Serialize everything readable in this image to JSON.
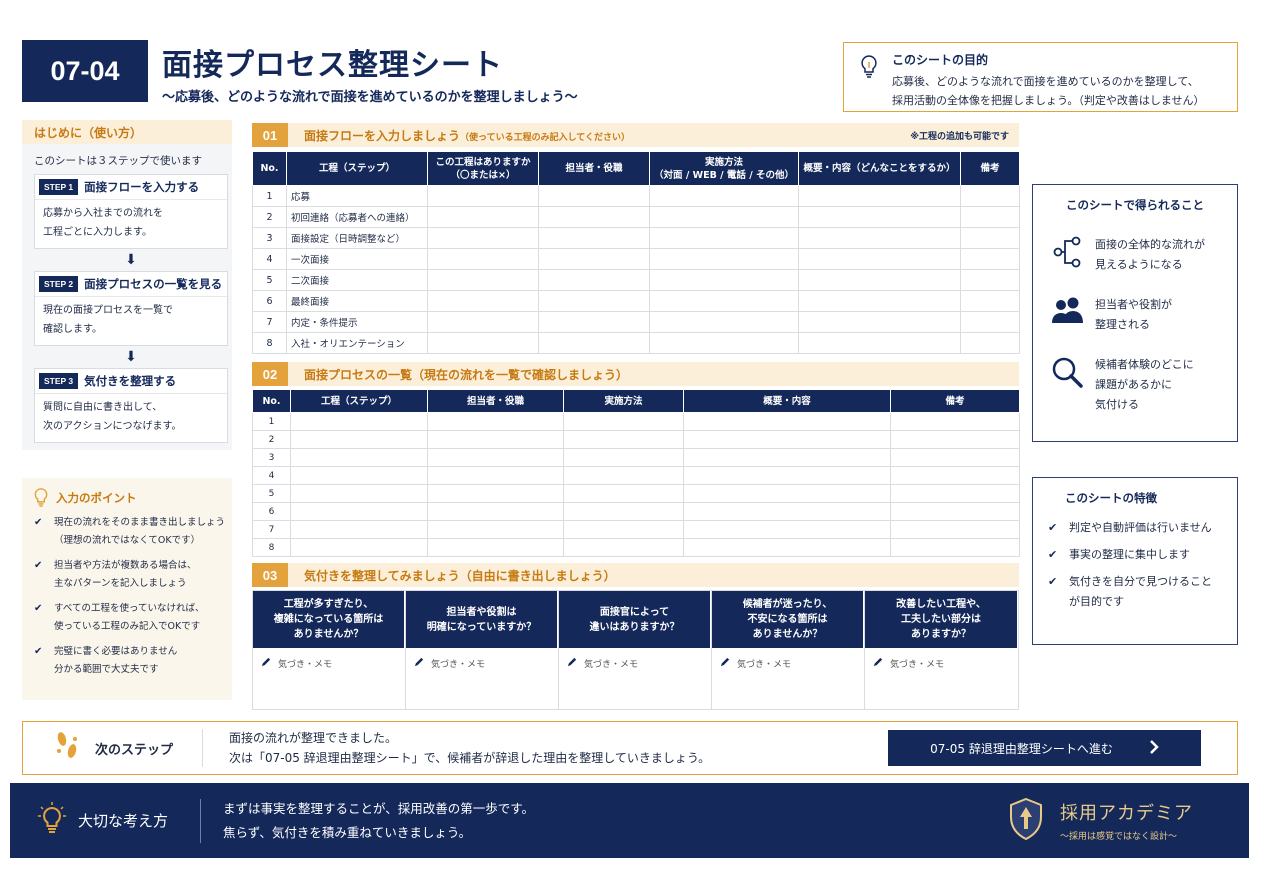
{
  "header": {
    "code": "07-04",
    "title": "面接プロセス整理シート",
    "subtitle": "〜応募後、どのような流れで面接を進めているのかを整理しましょう〜"
  },
  "purpose": {
    "title": "このシートの目的",
    "line1": "応募後、どのような流れで面接を進めているのかを整理して、",
    "line2": "採用活動の全体像を把握しましょう。（判定や改善はしません）"
  },
  "intro": {
    "heading": "はじめに（使い方）",
    "text": "このシートは３ステップで使います",
    "steps": [
      {
        "tag": "STEP 1",
        "title": "面接フローを入力する",
        "line1": "応募から入社までの流れを",
        "line2": "工程ごとに入力します。"
      },
      {
        "tag": "STEP 2",
        "title": "面接プロセスの一覧を見る",
        "line1": "現在の面接プロセスを一覧で",
        "line2": "確認します。"
      },
      {
        "tag": "STEP 3",
        "title": "気付きを整理する",
        "line1": "質問に自由に書き出して、",
        "line2": "次のアクションにつなげます。"
      }
    ]
  },
  "points": {
    "heading": "入力のポイント",
    "items": [
      {
        "line1": "現在の流れをそのまま書き出しましょう",
        "line2": "（理想の流れではなくてOKです）"
      },
      {
        "line1": "担当者や方法が複数ある場合は、",
        "line2": "主なパターンを記入しましょう"
      },
      {
        "line1": "すべての工程を使っていなければ、",
        "line2": "使っている工程のみ記入でOKです"
      },
      {
        "line1": "完璧に書く必要はありません",
        "line2": "分かる範囲で大丈夫です"
      }
    ]
  },
  "section1": {
    "num": "01",
    "title": "面接フローを入力しましょう",
    "title_small": "（使っている工程のみ記入してください）",
    "note": "※工程の追加も可能です",
    "headers": [
      "No.",
      "工程（ステップ）",
      "この工程はありますか\n（〇または×）",
      "担当者・役職",
      "実施方法\n（対面 / WEB / 電話 / その他）",
      "概要・内容（どんなことをするか）",
      "備考"
    ],
    "rows": [
      {
        "no": "1",
        "step": "応募"
      },
      {
        "no": "2",
        "step": "初回連絡（応募者への連絡）"
      },
      {
        "no": "3",
        "step": "面接設定（日時調整など）"
      },
      {
        "no": "4",
        "step": "一次面接"
      },
      {
        "no": "5",
        "step": "二次面接"
      },
      {
        "no": "6",
        "step": "最終面接"
      },
      {
        "no": "7",
        "step": "内定・条件提示"
      },
      {
        "no": "8",
        "step": "入社・オリエンテーション"
      }
    ]
  },
  "section2": {
    "num": "02",
    "title": "面接プロセスの一覧（現在の流れを一覧で確認しましょう）",
    "headers": [
      "No.",
      "工程（ステップ）",
      "担当者・役職",
      "実施方法",
      "概要・内容",
      "備考"
    ],
    "rows": [
      "1",
      "2",
      "3",
      "4",
      "5",
      "6",
      "7",
      "8"
    ]
  },
  "section3": {
    "num": "03",
    "title": "気付きを整理してみましょう（自由に書き出しましょう）",
    "memo": "気づき・メモ",
    "questions": [
      {
        "l1": "工程が多すぎたり、",
        "l2": "複雑になっている箇所は",
        "l3": "ありませんか？"
      },
      {
        "l1": "担当者や役割は",
        "l2": "明確になっていますか？",
        "l3": ""
      },
      {
        "l1": "面接官によって",
        "l2": "違いはありますか？",
        "l3": ""
      },
      {
        "l1": "候補者が迷ったり、",
        "l2": "不安になる箇所は",
        "l3": "ありませんか？"
      },
      {
        "l1": "改善したい工程や、",
        "l2": "工夫したい部分は",
        "l3": "ありますか？"
      }
    ]
  },
  "benefits": {
    "heading": "このシートで得られること",
    "items": [
      {
        "icon": "flow-icon",
        "l1": "面接の全体的な流れが",
        "l2": "見えるようになる",
        "l3": ""
      },
      {
        "icon": "people-icon",
        "l1": "担当者や役割が",
        "l2": "整理される",
        "l3": ""
      },
      {
        "icon": "magnifier-icon",
        "l1": "候補者体験のどこに",
        "l2": "課題があるかに",
        "l3": "気付ける"
      }
    ]
  },
  "features": {
    "heading": "このシートの特徴",
    "items": [
      {
        "l1": "判定や自動評価は行いません",
        "l2": ""
      },
      {
        "l1": "事実の整理に集中します",
        "l2": ""
      },
      {
        "l1": "気付きを自分で見つけること",
        "l2": "が目的です"
      }
    ]
  },
  "next": {
    "label": "次のステップ",
    "line1": "面接の流れが整理できました。",
    "line2": "次は「07-05 辞退理由整理シート」で、候補者が辞退した理由を整理していきましょう。",
    "button": "07-05 辞退理由整理シートへ進む"
  },
  "footer": {
    "label": "大切な考え方",
    "line1": "まずは事実を整理することが、採用改善の第一歩です。",
    "line2": "焦らず、気付きを積み重ねていきましょう。",
    "brand": "採用アカデミア",
    "brand_sub": "〜採用は感覚ではなく設計〜"
  },
  "colors": {
    "navy": "#14295a",
    "accent": "#e3a23b",
    "accent_text": "#c77a12"
  }
}
